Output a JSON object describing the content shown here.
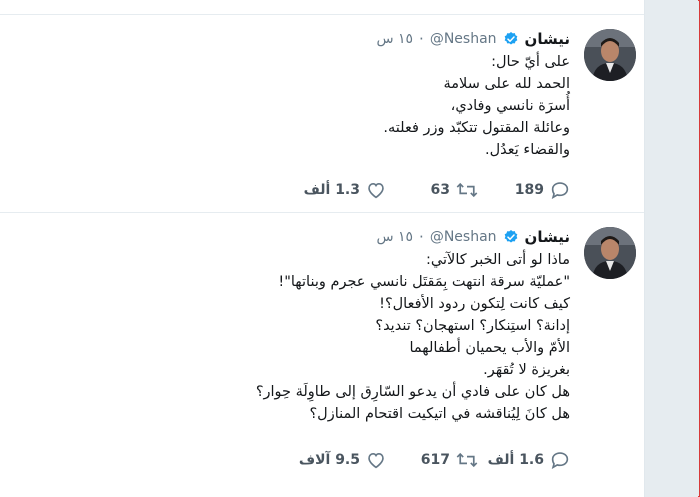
{
  "tweets": [
    {
      "author_name": "نيشان",
      "handle": "@Neshan",
      "separator": "·",
      "time": "١٥ س",
      "lines": [
        "على أيّ حال:",
        "الحمد لله على سلامة",
        "أُسرَة نانسي وفادي،",
        "وعائلة المقتول تتكبّد وزر فعلته.",
        "والقضاء يَعدُل."
      ],
      "replies": "189",
      "retweets": "63",
      "likes": "1.3 ألف"
    },
    {
      "author_name": "نيشان",
      "handle": "@Neshan",
      "separator": "·",
      "time": "١٥ س",
      "lines": [
        "ماذا لو أتى الخبر كالآتي:",
        "\"عمليّة سرقة انتهت بِمَقتَل نانسي عجرم وبناتها\"!",
        "كيف كانت لِتكون ردود الأفعال؟!",
        "إدانة؟ استِنكار؟ استهجان؟ تنديد؟",
        "الأمّ والأب يحميان أطفالهما",
        "بغريزة لا تُقهَر.",
        "هل كان على فادي أن يدعو السّارِق إلى طاوِلَة حِوار؟",
        "هل كانَ لِيُناقشه في اتيكيت اقتحام المنازل؟"
      ],
      "replies": "1.6 ألف",
      "retweets": "617",
      "likes": "9.5 آلاف"
    }
  ],
  "colors": {
    "verified": "#1da1f2",
    "muted": "#657786",
    "text": "#14171a",
    "frame_border": "#d83a3a"
  },
  "icons": {
    "reply": "reply-icon",
    "retweet": "retweet-icon",
    "like": "heart-icon",
    "verified": "verified-badge-icon"
  }
}
